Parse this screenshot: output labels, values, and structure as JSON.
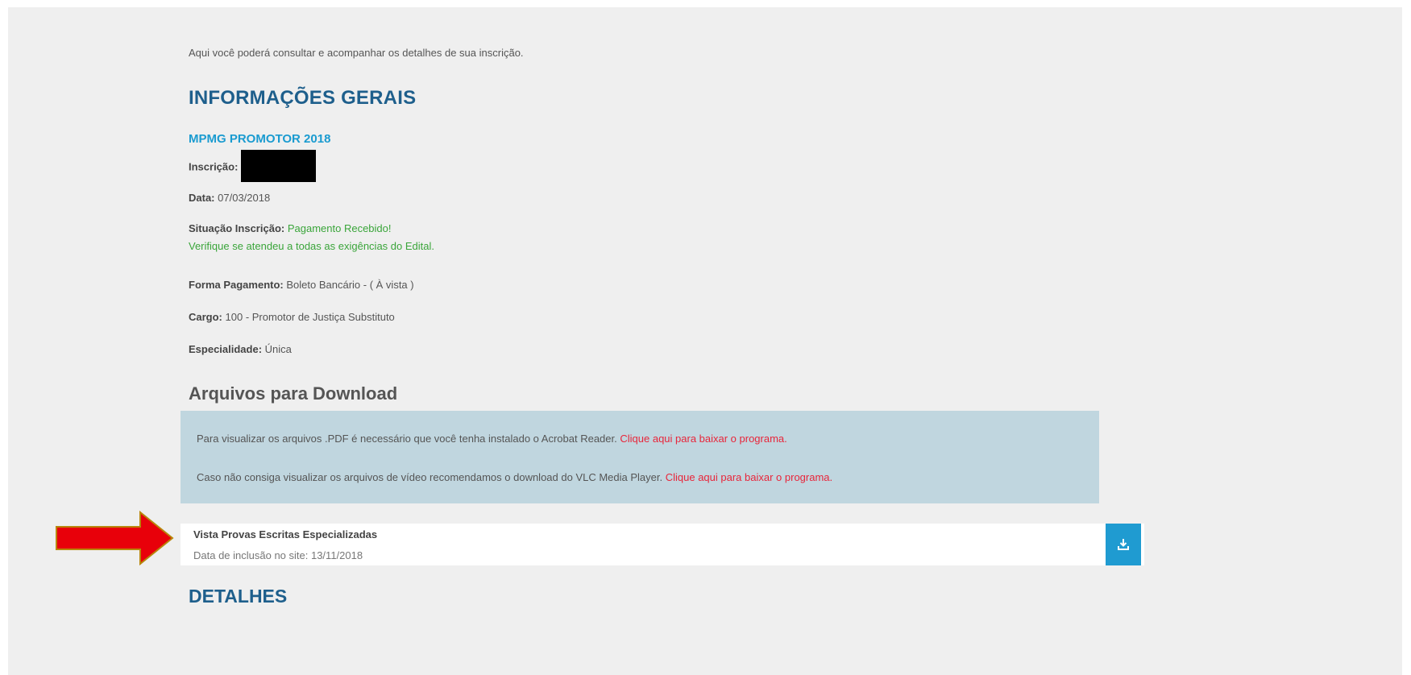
{
  "intro": "Aqui você poderá consultar e acompanhar os detalhes de sua inscrição.",
  "general": {
    "heading": "INFORMAÇÕES GERAIS",
    "contest": "MPMG PROMOTOR 2018",
    "inscricao_label": "Inscrição:",
    "data_label": "Data:",
    "data_value": "07/03/2018",
    "situacao_label": "Situação Inscrição:",
    "situacao_value": "Pagamento Recebido!",
    "situacao_note": "Verifique se atendeu a todas as exigências do Edital.",
    "pagamento_label": "Forma Pagamento:",
    "pagamento_value": "Boleto Bancário - ( À vista )",
    "cargo_label": "Cargo:",
    "cargo_value": "100 - Promotor de Justiça Substituto",
    "especialidade_label": "Especialidade:",
    "especialidade_value": "Única"
  },
  "downloads": {
    "heading": "Arquivos para Download",
    "pdf_note": "Para visualizar os arquivos .PDF é necessário que você tenha instalado o Acrobat Reader.",
    "pdf_link": "Clique aqui para baixar o programa.",
    "video_note": "Caso não consiga visualizar os arquivos de vídeo recomendamos o download do VLC Media Player.",
    "video_link": "Clique aqui para baixar o programa.",
    "files": [
      {
        "title": "Vista Provas Escritas Especializadas",
        "date": "Data de inclusão no site: 13/11/2018"
      }
    ]
  },
  "details_heading": "DETALHES",
  "colors": {
    "heading": "#1e5f8c",
    "contest": "#1a9bd0",
    "success": "#3aa53a",
    "link": "#e8253a",
    "info_box": "#c0d6df",
    "download_button": "#1f9bd1",
    "annotation_arrow": "#e8000a"
  },
  "icons": {
    "download": "download-icon",
    "annotation": "red-arrow-annotation"
  }
}
